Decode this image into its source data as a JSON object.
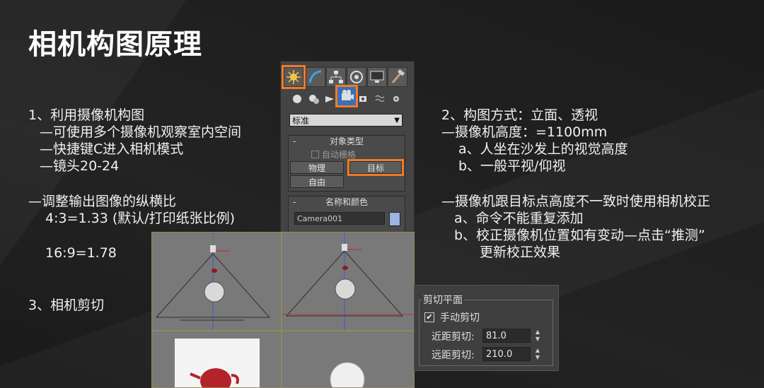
{
  "slide": {
    "title": "相机构图原理",
    "left_text": {
      "l1": "1、利用摄像机构图",
      "l2": "—可使用多个摄像机观察室内空间",
      "l3": "—快捷键C进入相机模式",
      "l4": "—镜头20-24",
      "l5": "—调整输出图像的纵横比",
      "l6": "4:3=1.33 (默认/打印纸张比例)",
      "l7": "16:9=1.78",
      "l8": "3、相机剪切"
    },
    "right_text": {
      "r1": "2、构图方式：立面、透视",
      "r2": "—摄像机高度：=1100mm",
      "r3": "a、人坐在沙发上的视觉高度",
      "r4": "b、一般平视/仰视",
      "r5": "—摄像机跟目标点高度不一致时使用相机校正",
      "r6": "a、命令不能重复添加",
      "r7": "b、校正摄像机位置如有变动—点击“推测”",
      "r8": "更新校正效果"
    }
  },
  "create_panel": {
    "dropdown_value": "标准",
    "object_type_title": "对象类型",
    "auto_grid_label": "自动栅格",
    "btn_physical": "物理",
    "btn_target": "目标",
    "btn_free": "自由",
    "name_color_title": "名称和颜色",
    "name_value": "Camera001",
    "swatch_color": "#9bb4e0",
    "highlight_color": "#ee7a2b"
  },
  "clipping": {
    "group_title": "剪切平面",
    "manual_clip_label": "手动剪切",
    "manual_clip_checked": true,
    "near_label": "近距剪切:",
    "near_value": "81.0",
    "far_label": "远距剪切:",
    "far_value": "210.0"
  }
}
